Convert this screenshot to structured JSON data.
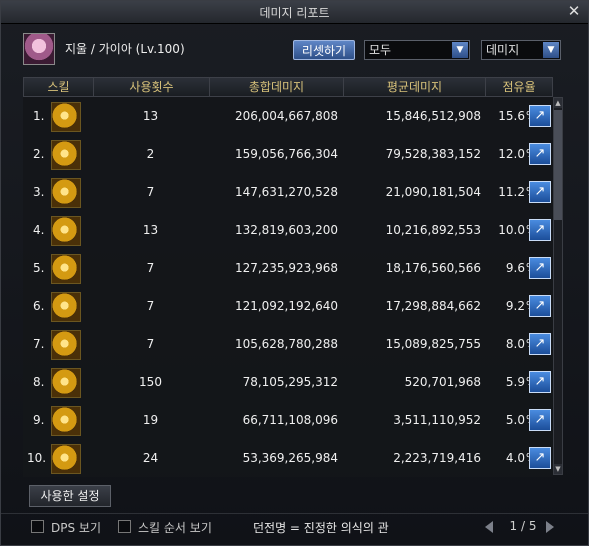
{
  "window": {
    "title": "데미지 리포트"
  },
  "header": {
    "character": "지울 / 가이아 (Lv.100)",
    "reset_label": "리셋하기",
    "filter_value": "모두",
    "type_value": "데미지"
  },
  "table": {
    "columns": [
      "스킬",
      "사용횟수",
      "총합데미지",
      "평균데미지",
      "점유율"
    ],
    "pct_symbol": "%",
    "rows": [
      {
        "rank": "1.",
        "uses": "13",
        "total": "206,004,667,808",
        "avg": "15,846,512,908",
        "share": "15.6"
      },
      {
        "rank": "2.",
        "uses": "2",
        "total": "159,056,766,304",
        "avg": "79,528,383,152",
        "share": "12.0"
      },
      {
        "rank": "3.",
        "uses": "7",
        "total": "147,631,270,528",
        "avg": "21,090,181,504",
        "share": "11.2"
      },
      {
        "rank": "4.",
        "uses": "13",
        "total": "132,819,603,200",
        "avg": "10,216,892,553",
        "share": "10.0"
      },
      {
        "rank": "5.",
        "uses": "7",
        "total": "127,235,923,968",
        "avg": "18,176,560,566",
        "share": "9.6"
      },
      {
        "rank": "6.",
        "uses": "7",
        "total": "121,092,192,640",
        "avg": "17,298,884,662",
        "share": "9.2"
      },
      {
        "rank": "7.",
        "uses": "7",
        "total": "105,628,780,288",
        "avg": "15,089,825,755",
        "share": "8.0"
      },
      {
        "rank": "8.",
        "uses": "150",
        "total": "78,105,295,312",
        "avg": "520,701,968",
        "share": "5.9"
      },
      {
        "rank": "9.",
        "uses": "19",
        "total": "66,711,108,096",
        "avg": "3,511,110,952",
        "share": "5.0"
      },
      {
        "rank": "10.",
        "uses": "24",
        "total": "53,369,265,984",
        "avg": "2,223,719,416",
        "share": "4.0"
      }
    ]
  },
  "tabs": {
    "used_label": "사용한 설정"
  },
  "footer": {
    "dps_label": "DPS 보기",
    "order_label": "스킬 순서 보기",
    "dungeon": "던전명 = 진정한 의식의 관",
    "page": "1 / 5"
  },
  "colors": {
    "accent": "#2e4f88",
    "header_text": "#d8c27a"
  },
  "icons": {
    "close": "close-icon",
    "share": "share-icon",
    "dropdown": "chevron-down-icon"
  }
}
